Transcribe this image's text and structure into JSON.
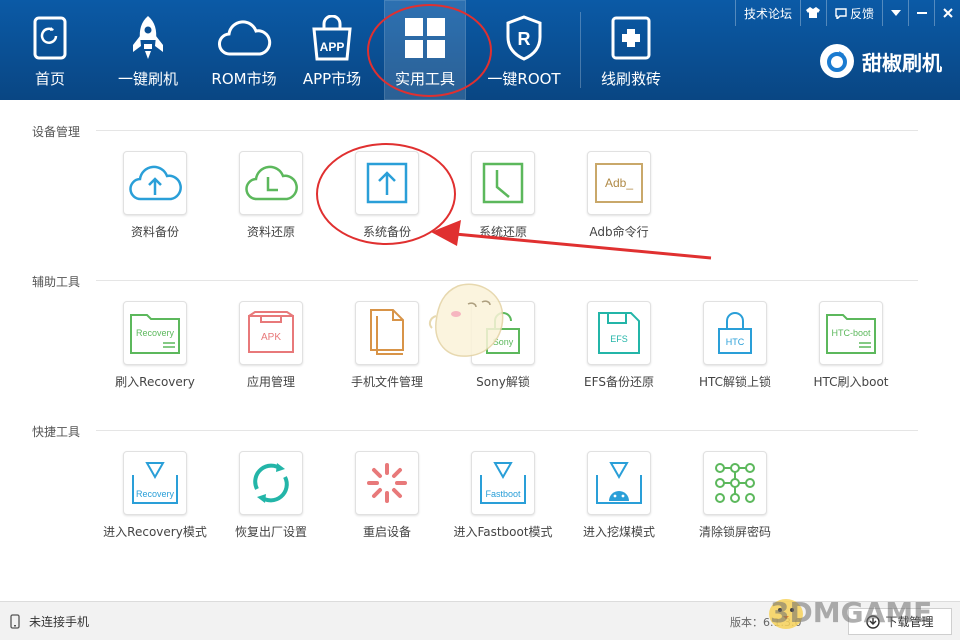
{
  "header": {
    "nav": [
      {
        "label": "首页",
        "icon": "phone-refresh-icon"
      },
      {
        "label": "一键刷机",
        "icon": "rocket-icon"
      },
      {
        "label": "ROM市场",
        "icon": "cloud-icon"
      },
      {
        "label": "APP市场",
        "icon": "shopping-bag-icon",
        "badge": "APP"
      },
      {
        "label": "实用工具",
        "icon": "grid-icon",
        "active": true
      },
      {
        "label": "一键ROOT",
        "icon": "shield-r-icon",
        "badge": "R"
      },
      {
        "label": "线刷救砖",
        "icon": "first-aid-icon"
      }
    ],
    "top_links": {
      "forum": "技术论坛",
      "feedback": "反馈"
    },
    "brand": "甜椒刷机"
  },
  "sections": [
    {
      "title": "设备管理",
      "tools": [
        {
          "label": "资料备份",
          "icon": "cloud-upload-icon"
        },
        {
          "label": "资料还原",
          "icon": "cloud-clock-icon"
        },
        {
          "label": "系统备份",
          "icon": "box-upload-icon"
        },
        {
          "label": "系统还原",
          "icon": "box-clock-icon"
        },
        {
          "label": "Adb命令行",
          "icon": "adb-terminal-icon",
          "tile_text": "Adb_"
        }
      ]
    },
    {
      "title": "辅助工具",
      "tools": [
        {
          "label": "刷入Recovery",
          "icon": "recovery-folder-icon",
          "tile_text": "Recovery"
        },
        {
          "label": "应用管理",
          "icon": "apk-tray-icon",
          "tile_text": "APK"
        },
        {
          "label": "手机文件管理",
          "icon": "files-icon"
        },
        {
          "label": "Sony解锁",
          "icon": "sony-unlock-icon",
          "tile_text": "Sony"
        },
        {
          "label": "EFS备份还原",
          "icon": "efs-disk-icon",
          "tile_text": "EFS"
        },
        {
          "label": "HTC解锁上锁",
          "icon": "htc-lock-icon",
          "tile_text": "HTC"
        },
        {
          "label": "HTC刷入boot",
          "icon": "htc-boot-folder-icon",
          "tile_text": "HTC-boot"
        }
      ]
    },
    {
      "title": "快捷工具",
      "tools": [
        {
          "label": "进入Recovery模式",
          "icon": "recovery-mode-icon",
          "tile_text": "Recovery"
        },
        {
          "label": "恢复出厂设置",
          "icon": "factory-reset-icon"
        },
        {
          "label": "重启设备",
          "icon": "reboot-spinner-icon"
        },
        {
          "label": "进入Fastboot模式",
          "icon": "fastboot-mode-icon",
          "tile_text": "Fastboot"
        },
        {
          "label": "进入挖煤模式",
          "icon": "android-download-icon"
        },
        {
          "label": "清除锁屏密码",
          "icon": "pattern-lock-icon"
        }
      ]
    }
  ],
  "footer": {
    "status": "未连接手机",
    "version": "版本：6.1.3.0",
    "download_button": "下载管理"
  },
  "watermark": "3DMGAME",
  "colors": {
    "header": "#0a4f93",
    "accent_blue": "#2a9fd8",
    "accent_green": "#5cb85c",
    "accent_red": "#e0302f",
    "annotation": "#e03030"
  }
}
